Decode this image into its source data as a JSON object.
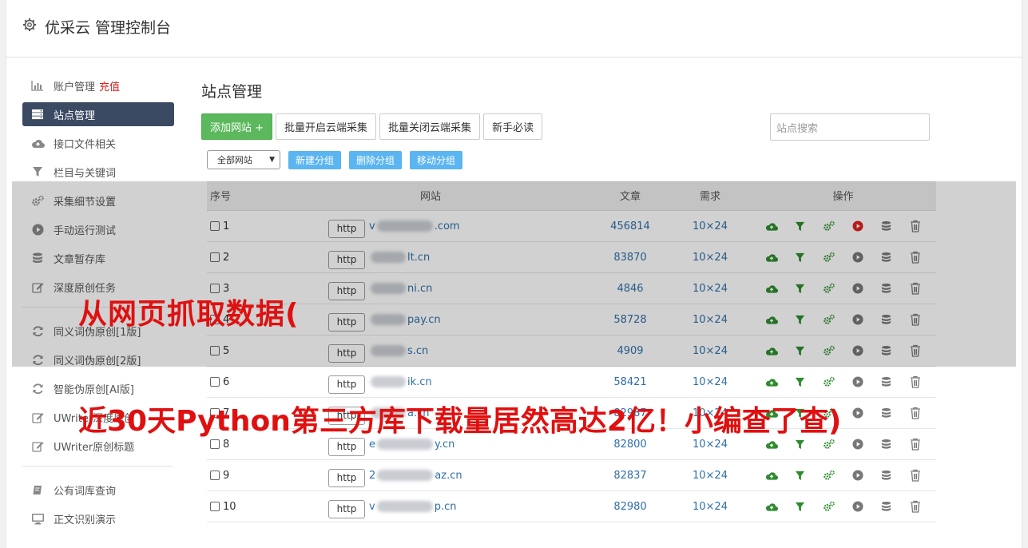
{
  "header": {
    "title": "优采云 管理控制台",
    "icon": "gear-icon"
  },
  "sidebar": {
    "items": [
      {
        "label": "账户管理",
        "extra": "充值",
        "icon": "bar-chart-icon",
        "active": false
      },
      {
        "label": "站点管理",
        "icon": "server-icon",
        "active": true
      },
      {
        "label": "接口文件相关",
        "icon": "cloud-upload-icon",
        "active": false
      },
      {
        "label": "栏目与关键词",
        "icon": "filter-icon",
        "active": false
      },
      {
        "label": "采集细节设置",
        "icon": "cogs-icon",
        "active": false
      },
      {
        "label": "手动运行测试",
        "icon": "play-circle-icon",
        "active": false
      },
      {
        "label": "文章暂存库",
        "icon": "database-icon",
        "active": false
      },
      {
        "label": "深度原创任务",
        "icon": "edit-icon",
        "active": false
      }
    ],
    "items2": [
      {
        "label": "同义词伪原创[1版]",
        "icon": "refresh-icon"
      },
      {
        "label": "同义词伪原创[2版]",
        "icon": "refresh-icon"
      },
      {
        "label": "智能伪原创[AI版]",
        "icon": "refresh-icon"
      },
      {
        "label": "UWriter深度原创",
        "icon": "edit-icon"
      },
      {
        "label": "UWriter原创标题",
        "icon": "edit-icon"
      }
    ],
    "items3": [
      {
        "label": "公有词库查询",
        "icon": "book-icon"
      },
      {
        "label": "正文识别演示",
        "icon": "monitor-icon"
      }
    ]
  },
  "main": {
    "title": "站点管理",
    "buttons": {
      "add": "添加网站 +",
      "batch_on": "批量开启云端采集",
      "batch_off": "批量关闭云端采集",
      "guide": "新手必读"
    },
    "search_placeholder": "站点搜索",
    "group_select": "全部网站",
    "group_buttons": {
      "new": "新建分组",
      "delete": "删除分组",
      "move": "移动分组"
    },
    "table": {
      "headers": {
        "no": "序号",
        "site": "网站",
        "articles": "文章",
        "demand": "需求",
        "ops": "操作"
      },
      "http_label": "http",
      "rows": [
        {
          "no": "1",
          "prefix": "v",
          "suffix": ".com",
          "articles": "456814",
          "demand": "10×24",
          "running": true
        },
        {
          "no": "2",
          "prefix": "",
          "suffix": "lt.cn",
          "articles": "83870",
          "demand": "10×24",
          "running": false
        },
        {
          "no": "3",
          "prefix": "",
          "suffix": "ni.cn",
          "articles": "4846",
          "demand": "10×24",
          "running": false
        },
        {
          "no": "4",
          "prefix": "",
          "suffix": "pay.cn",
          "articles": "58728",
          "demand": "10×24",
          "running": false
        },
        {
          "no": "5",
          "prefix": "",
          "suffix": "s.cn",
          "articles": "4909",
          "demand": "10×24",
          "running": false
        },
        {
          "no": "6",
          "prefix": "",
          "suffix": "ik.cn",
          "articles": "58421",
          "demand": "10×24",
          "running": false
        },
        {
          "no": "7",
          "prefix": "",
          "suffix": "a.cn",
          "articles": "82987",
          "demand": "10×24",
          "running": false
        },
        {
          "no": "8",
          "prefix": "e",
          "suffix": "y.cn",
          "articles": "82800",
          "demand": "10×24",
          "running": false
        },
        {
          "no": "9",
          "prefix": "2",
          "suffix": "az.cn",
          "articles": "82837",
          "demand": "10×24",
          "running": false
        },
        {
          "no": "10",
          "prefix": "v",
          "suffix": "p.cn",
          "articles": "82980",
          "demand": "10×24",
          "running": false
        }
      ]
    }
  },
  "overlay": {
    "line1": "从网页抓取数据(",
    "line2": "近30天Python第三方库下载量居然高达2亿！小编查了查)"
  },
  "colors": {
    "accent_green": "#5cb85c",
    "nav_active": "#3b4a63",
    "link_blue": "#2f6fa8",
    "overlay_red": "#e01010",
    "op_green": "#2e8b2e",
    "op_red": "#e02020"
  }
}
